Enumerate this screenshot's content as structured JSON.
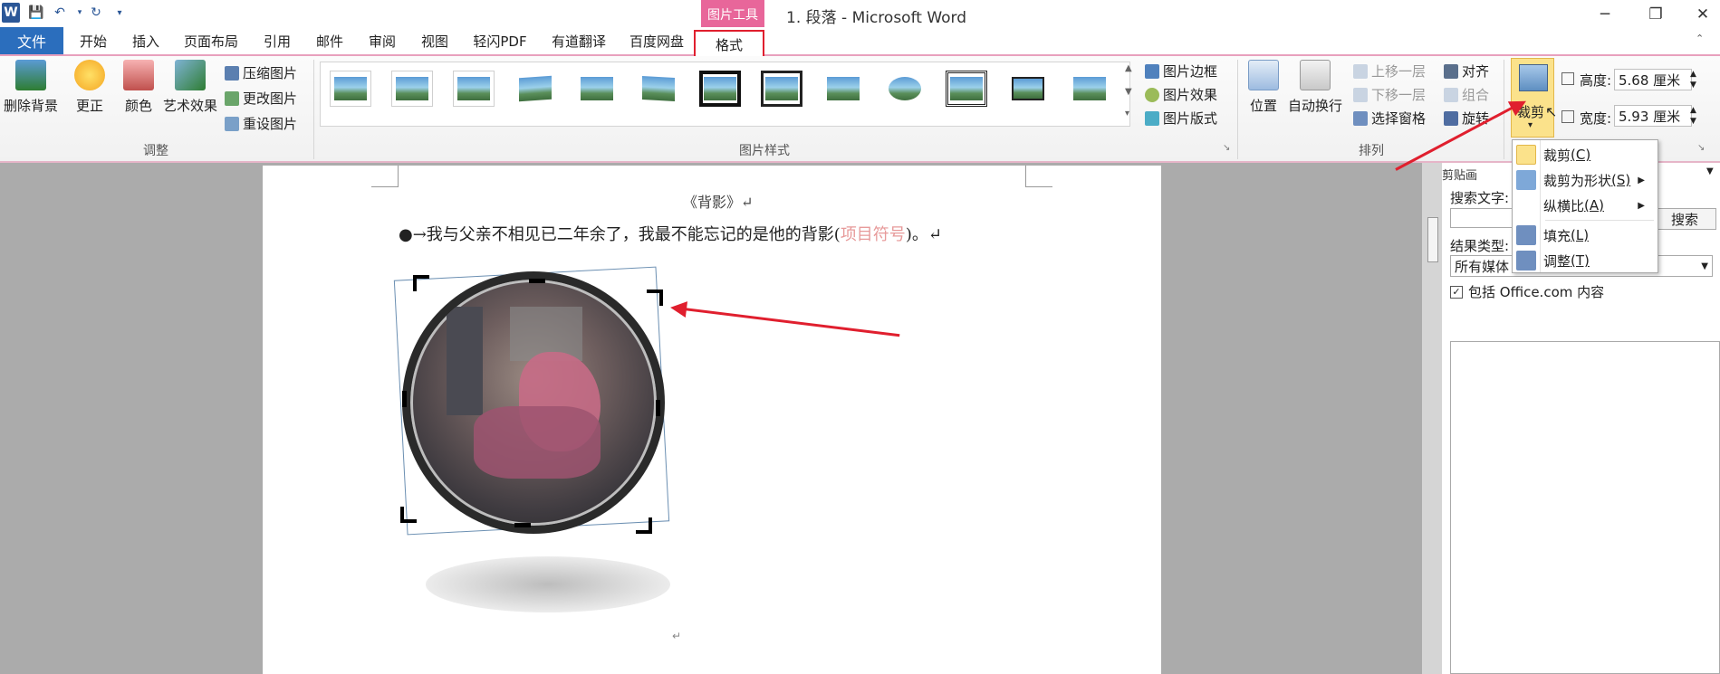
{
  "title_bar": {
    "app_icon": "W",
    "quick_access": [
      "save-icon",
      "undo-icon",
      "redo-icon",
      "customize-icon"
    ],
    "contextual_tab": "图片工具",
    "document_title": "1. 段落 - Microsoft Word",
    "window_buttons": [
      "─",
      "❐",
      "✕"
    ]
  },
  "tabs": {
    "file": "文件",
    "items": [
      "开始",
      "插入",
      "页面布局",
      "引用",
      "邮件",
      "审阅",
      "视图",
      "轻闪PDF",
      "有道翻译",
      "百度网盘"
    ],
    "active": "格式"
  },
  "ribbon": {
    "adjust": {
      "remove_bg": "删除背景",
      "corrections": "更正",
      "color": "颜色",
      "artistic": "艺术效果",
      "compress": "压缩图片",
      "change": "更改图片",
      "reset": "重设图片",
      "label": "调整"
    },
    "styles": {
      "border": "图片边框",
      "effects": "图片效果",
      "layout": "图片版式",
      "label": "图片样式"
    },
    "arrange": {
      "position": "位置",
      "wrap": "自动换行",
      "bring_forward": "上移一层",
      "send_backward": "下移一层",
      "selection_pane": "选择窗格",
      "align": "对齐",
      "group": "组合",
      "rotate": "旋转",
      "label": "排列"
    },
    "size": {
      "crop": "裁剪",
      "height_label": "高度:",
      "height_value": "5.68 厘米",
      "width_label": "宽度:",
      "width_value": "5.93 厘米"
    }
  },
  "document": {
    "heading": "《背影》↵",
    "paragraph_main": "●→我与父亲不相见已二年余了，我最不能忘记的是他的背影(",
    "paragraph_note": "项目符号",
    "paragraph_end": ")。↵",
    "end_mark": "↵"
  },
  "crop_menu": {
    "items": [
      {
        "label": "裁剪",
        "key": "(C)"
      },
      {
        "label": "裁剪为形状",
        "key": "(S)"
      },
      {
        "label": "纵横比",
        "key": "(A)"
      },
      {
        "label": "填充",
        "key": "(L)"
      },
      {
        "label": "调整",
        "key": "(T)"
      }
    ]
  },
  "clipboard_pane": {
    "title": "剪贴画",
    "search_label": "搜索文字:",
    "search_value": "",
    "search_button": "搜索",
    "result_label": "结果类型:",
    "result_value": "所有媒体",
    "include_label": "包括 Office.com 内容",
    "include_checked": true
  },
  "colors": {
    "accent_pink": "#e8669a",
    "file_blue": "#2b6ebd",
    "crop_highlight": "#fbe28b",
    "arrow_red": "#e01f2e"
  }
}
